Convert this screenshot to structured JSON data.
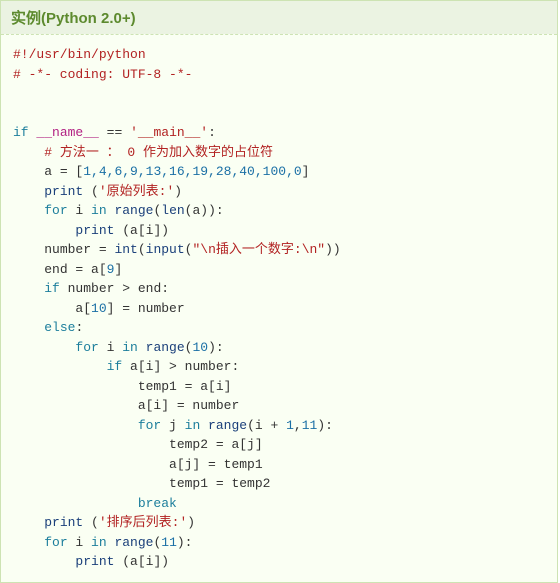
{
  "header": "实例(Python 2.0+)",
  "code": {
    "l1_shebang": "#!/usr/bin/python",
    "l2_coding": "# -*- coding: UTF-8 -*-",
    "l5_if": "if",
    "l5_name": "__name__",
    "l5_eq": " == ",
    "l5_main": "'__main__'",
    "l5_colon": ":",
    "l6_comment": "# 方法一 ： 0 作为加入数字的占位符",
    "l7_a": "a = [",
    "l7_nums": "1,4,6,9,13,16,19,28,40,100,0",
    "l7_close": "]",
    "l8_print": "print",
    "l8_paren": " (",
    "l8_str": "'原始列表:'",
    "l8_close": ")",
    "l9_for": "for",
    "l9_i": " i ",
    "l9_in": "in",
    "l9_range": " range",
    "l9_len": "len",
    "l9_rest": "(a)):",
    "l10_print": "print",
    "l10_rest": " (a[i])",
    "l11_num": "number = ",
    "l11_int": "int",
    "l11_p1": "(",
    "l11_input": "input",
    "l11_p2": "(",
    "l11_str": "\"\\n插入一个数字:\\n\"",
    "l11_close": "))",
    "l12_end": "end = a[",
    "l12_9": "9",
    "l12_close": "]",
    "l13_if": "if",
    "l13_rest": " number > end:",
    "l14_a": "a[",
    "l14_10": "10",
    "l14_rest": "] = number",
    "l15_else": "else",
    "l15_colon": ":",
    "l16_for": "for",
    "l16_i": " i ",
    "l16_in": "in",
    "l16_range": " range",
    "l16_p": "(",
    "l16_10": "10",
    "l16_close": "):",
    "l17_if": "if",
    "l17_rest": " a[i] > number:",
    "l18": "temp1 = a[i]",
    "l19": "a[i] = number",
    "l20_for": "for",
    "l20_j": " j ",
    "l20_in": "in",
    "l20_range": " range",
    "l20_p": "(i + ",
    "l20_1": "1",
    "l20_c": ",",
    "l20_11": "11",
    "l20_close": "):",
    "l21": "temp2 = a[j]",
    "l22": "a[j] = temp1",
    "l23": "temp1 = temp2",
    "l24_break": "break",
    "l25_print": "print",
    "l25_p": " (",
    "l25_str": "'排序后列表:'",
    "l25_close": ")",
    "l26_for": "for",
    "l26_i": " i ",
    "l26_in": "in",
    "l26_range": " range",
    "l26_p": "(",
    "l26_11": "11",
    "l26_close": "):",
    "l27_print": "print",
    "l27_rest": " (a[i])"
  }
}
